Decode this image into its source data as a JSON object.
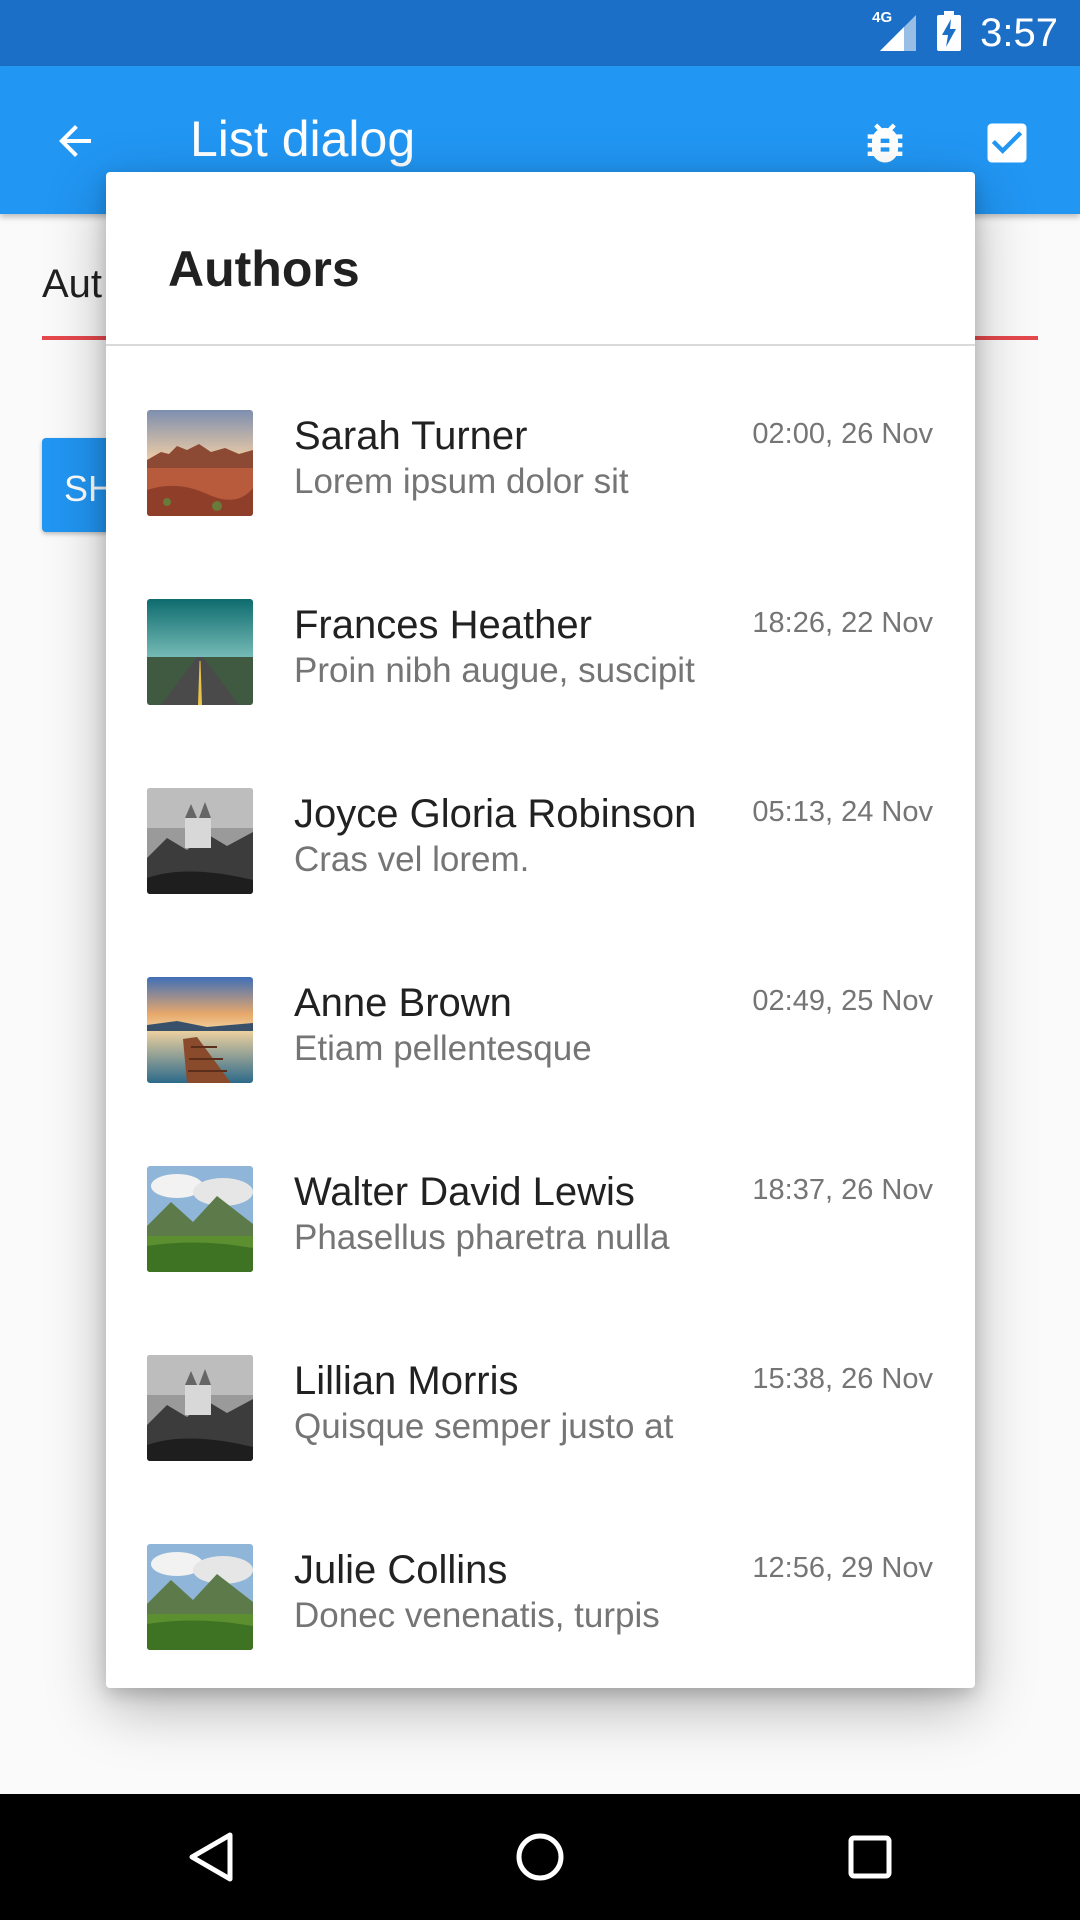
{
  "status_bar": {
    "network": "4G",
    "time": "3:57"
  },
  "app_bar": {
    "title": "List dialog",
    "back_icon": "arrow-back-icon",
    "bug_icon": "bug-icon",
    "confirm_icon": "checkbox-icon"
  },
  "background": {
    "input_text": "Aut",
    "button_label": "SH",
    "underline_color": "#e5484d",
    "accent_color": "#2196f3"
  },
  "dialog": {
    "title": "Authors",
    "items": [
      {
        "name": "Sarah Turner",
        "subtitle": "Lorem ipsum dolor sit",
        "time": "02:00, 26 Nov",
        "thumbnail": "canyon"
      },
      {
        "name": "Frances Heather",
        "subtitle": "Proin nibh augue, suscipit",
        "time": "18:26, 22 Nov",
        "thumbnail": "road"
      },
      {
        "name": "Joyce Gloria Robinson",
        "subtitle": "Cras vel lorem.",
        "time": "05:13, 24 Nov",
        "thumbnail": "castle"
      },
      {
        "name": "Anne Brown",
        "subtitle": "Etiam pellentesque",
        "time": "02:49, 25 Nov",
        "thumbnail": "pier"
      },
      {
        "name": "Walter David Lewis",
        "subtitle": "Phasellus pharetra nulla",
        "time": "18:37, 26 Nov",
        "thumbnail": "mountains"
      },
      {
        "name": "Lillian Morris",
        "subtitle": "Quisque semper justo at",
        "time": "15:38, 26 Nov",
        "thumbnail": "castle"
      },
      {
        "name": "Julie Collins",
        "subtitle": "Donec venenatis, turpis",
        "time": "12:56, 29 Nov",
        "thumbnail": "mountains"
      }
    ]
  },
  "nav_bar": {
    "back_icon": "nav-back-icon",
    "home_icon": "nav-home-icon",
    "recents_icon": "nav-recents-icon"
  }
}
